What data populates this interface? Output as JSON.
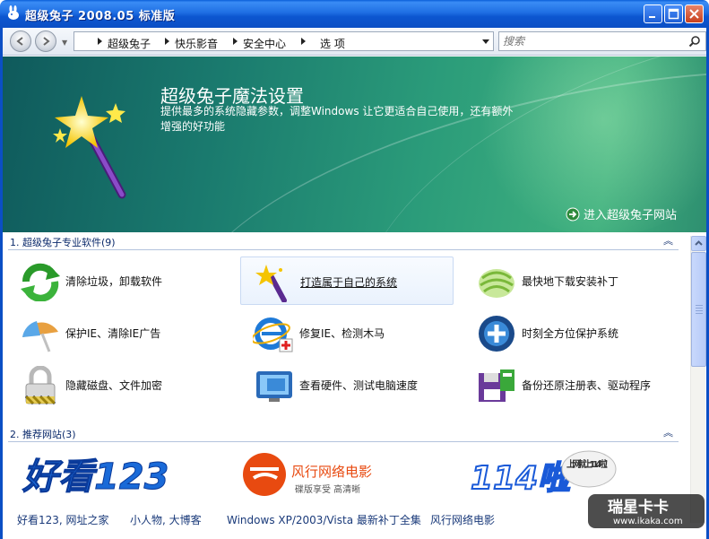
{
  "window": {
    "title": "超级兔子 2008.05 标准版"
  },
  "nav": {
    "breadcrumbs": [
      "超级兔子",
      "快乐影音",
      "安全中心",
      "选 项"
    ],
    "search_placeholder": "搜索"
  },
  "banner": {
    "title": "超级兔子魔法设置",
    "description": "提供最多的系统隐藏参数，调整Windows 让它更适合自己使用，还有额外增强的好功能",
    "link": "进入超级兔子网站"
  },
  "sections": [
    {
      "label": "1. 超级兔子专业软件(9)",
      "collapse": "︽",
      "items": [
        {
          "label": "清除垃圾，卸载软件",
          "icon": "recycle-arrows-icon"
        },
        {
          "label": "打造属于自己的系统",
          "icon": "magic-wand-icon"
        },
        {
          "label": "最快地下载安装补丁",
          "icon": "wings-icon"
        },
        {
          "label": "保护IE、清除IE广告",
          "icon": "umbrella-icon"
        },
        {
          "label": "修复IE、检测木马",
          "icon": "ie-repair-icon"
        },
        {
          "label": "时刻全方位保护系统",
          "icon": "shield-cross-icon"
        },
        {
          "label": "隐藏磁盘、文件加密",
          "icon": "padlock-icon"
        },
        {
          "label": "查看硬件、测试电脑速度",
          "icon": "monitor-icon"
        },
        {
          "label": "备份还原注册表、驱动程序",
          "icon": "floppy-backup-icon"
        }
      ]
    },
    {
      "label": "2. 推荐网站(3)",
      "collapse": "︽",
      "sites": [
        {
          "logo_text": "好看123"
        },
        {
          "logo_text": "风行网络电影",
          "logo_sub": "碟版享受 高清晰"
        },
        {
          "logo_text": "114啦",
          "logo_bubble": "上网就上114啦！"
        }
      ],
      "links": [
        "好看123, 网址之家",
        "小人物, 大博客",
        "Windows XP/2003/Vista 最新补丁全集",
        "风行网络电影"
      ]
    }
  ],
  "watermark": {
    "line1": "瑞星卡卡",
    "line2": "www.ikaka.com"
  },
  "colors": {
    "titlebar": "#0c56d0",
    "banner": "#1a7a6e",
    "section_header": "#0b2a6b"
  }
}
